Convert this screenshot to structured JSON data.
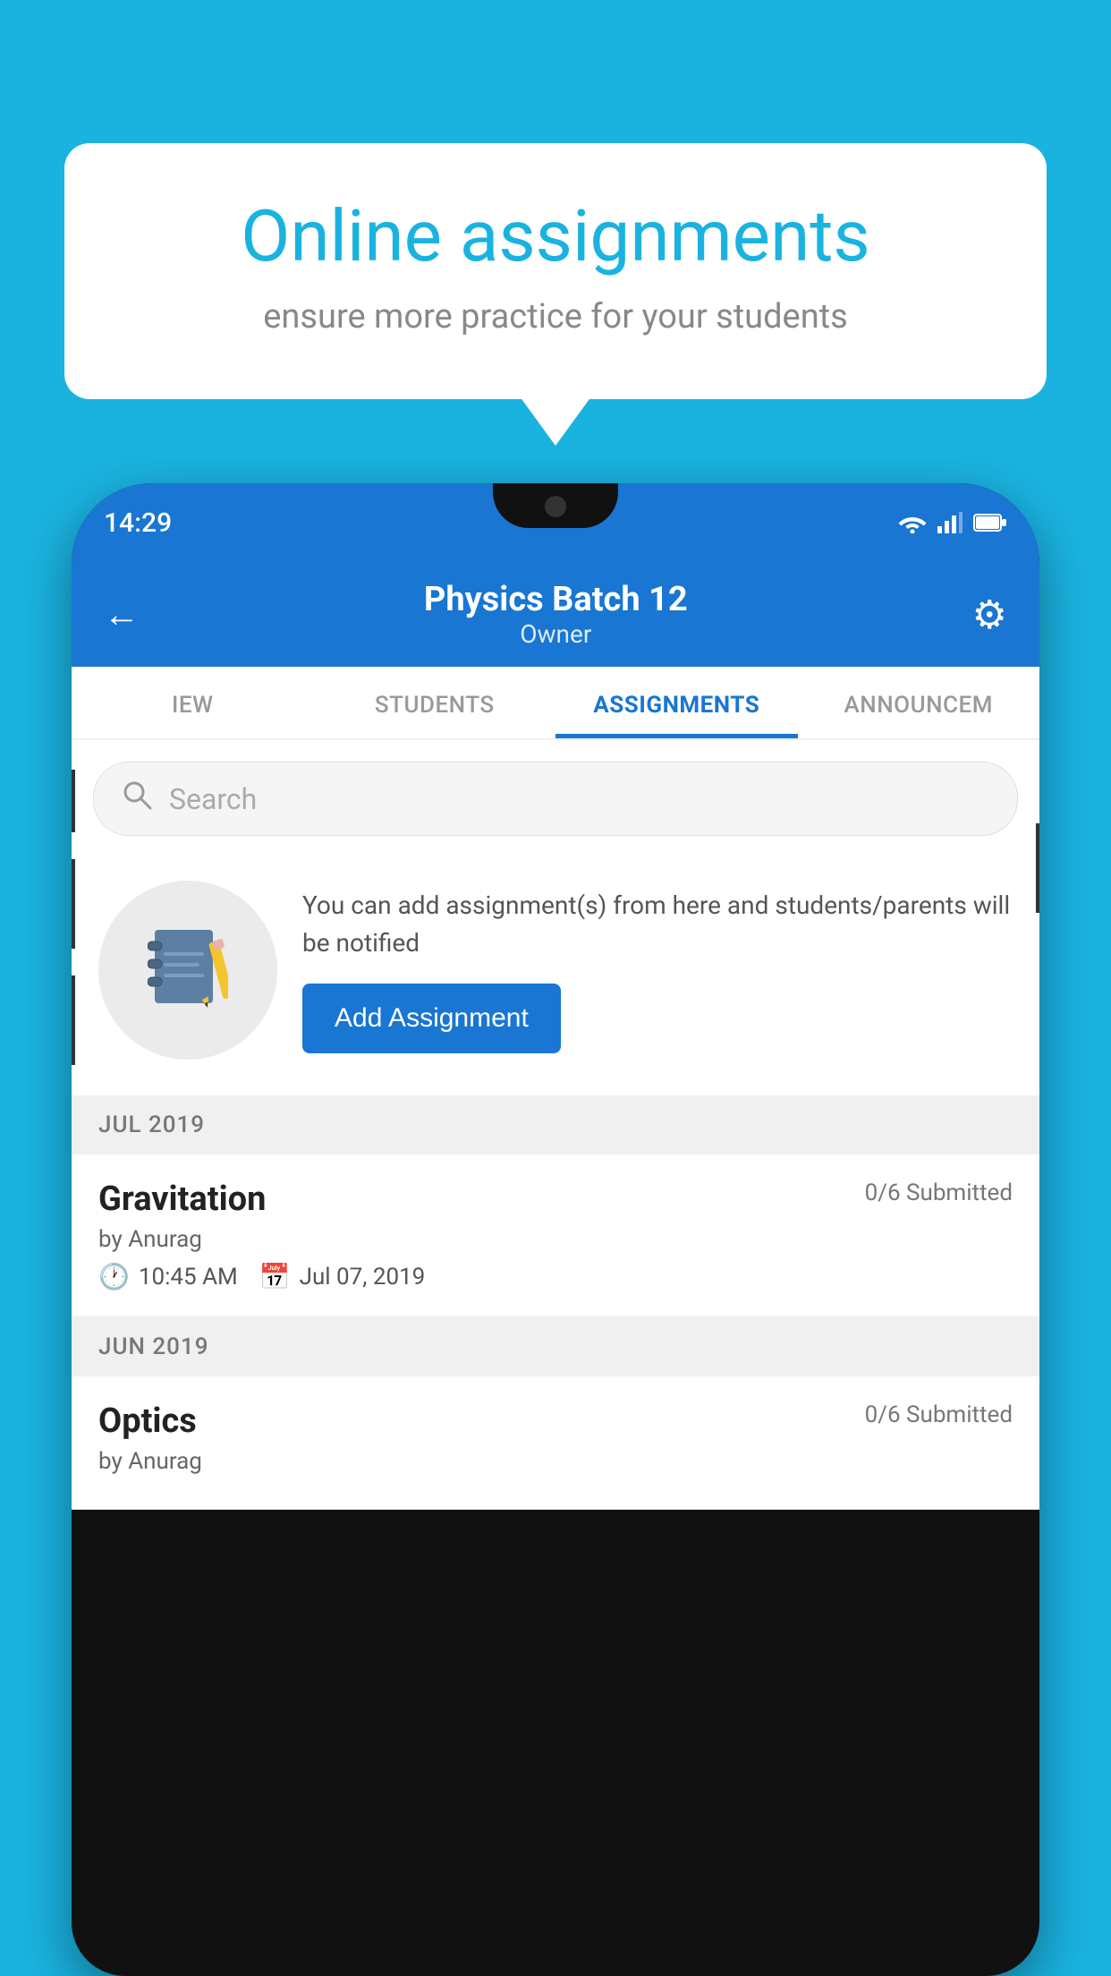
{
  "background_color": "#1ab3e0",
  "speech_bubble": {
    "title": "Online assignments",
    "subtitle": "ensure more practice for your students"
  },
  "phone": {
    "status_bar": {
      "time": "14:29",
      "wifi": true,
      "signal": true,
      "battery": true
    },
    "header": {
      "title": "Physics Batch 12",
      "subtitle": "Owner",
      "back_label": "←",
      "gear_label": "⚙"
    },
    "tabs": [
      {
        "label": "IEW",
        "active": false
      },
      {
        "label": "STUDENTS",
        "active": false
      },
      {
        "label": "ASSIGNMENTS",
        "active": true
      },
      {
        "label": "ANNOUNCEM",
        "active": false
      }
    ],
    "search": {
      "placeholder": "Search"
    },
    "promo": {
      "text": "You can add assignment(s) from here and students/parents will be notified",
      "button_label": "Add Assignment"
    },
    "sections": [
      {
        "label": "JUL 2019",
        "assignments": [
          {
            "name": "Gravitation",
            "submitted": "0/6 Submitted",
            "by": "by Anurag",
            "time": "10:45 AM",
            "date": "Jul 07, 2019"
          }
        ]
      },
      {
        "label": "JUN 2019",
        "assignments": [
          {
            "name": "Optics",
            "submitted": "0/6 Submitted",
            "by": "by Anurag",
            "time": "",
            "date": ""
          }
        ]
      }
    ]
  }
}
